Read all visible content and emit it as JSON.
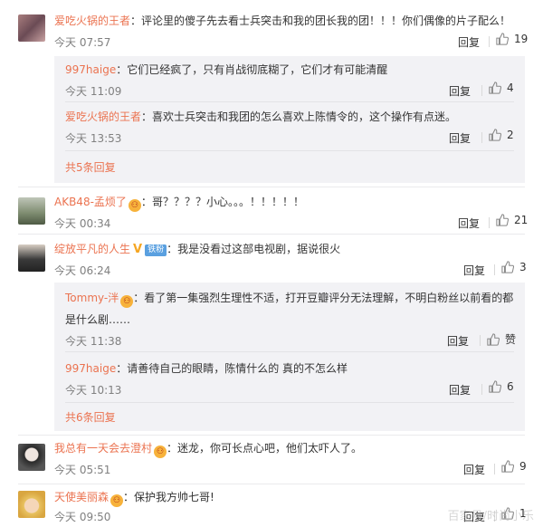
{
  "comments": [
    {
      "user": "爱吃火锅的王者",
      "text": "评论里的傻子先去看士兵突击和我的团长我的团！！！你们偶像的片子配么！",
      "time": "今天 07:57",
      "reply": "回复",
      "likes": "19",
      "replies": [
        {
          "user": "997haige",
          "text": "它们已经疯了，只有肖战彻底糊了，它们才有可能清醒",
          "time": "今天 11:09",
          "reply": "回复",
          "likes": "4"
        },
        {
          "user": "爱吃火锅的王者",
          "text": "喜欢士兵突击和我团的怎么喜欢上陈情令的，这个操作有点迷。",
          "time": "今天 13:53",
          "reply": "回复",
          "likes": "2"
        }
      ],
      "more": "共5条回复"
    },
    {
      "user": "AKB48-孟烦了",
      "text": "哥？？？？小心。。。！！！！！",
      "time": "今天 00:34",
      "reply": "回复",
      "likes": "21"
    },
    {
      "user": "绽放平凡的人生",
      "badge": "铁粉",
      "text": "我是没看过这部电视剧，据说很火",
      "time": "今天 06:24",
      "reply": "回复",
      "likes": "3",
      "replies": [
        {
          "user": "Tommy-泮",
          "text": "看了第一集强烈生理性不适，打开豆瓣评分无法理解，不明白粉丝以前看的都",
          "text2": "是什么剧……",
          "time": "今天 11:38",
          "reply": "回复",
          "likes": "赞"
        },
        {
          "user": "997haige",
          "text": "请善待自己的眼睛，陈情什么的 真的不怎么样",
          "time": "今天 10:13",
          "reply": "回复",
          "likes": "6"
        }
      ],
      "more": "共6条回复"
    },
    {
      "user": "我总有一天会去澄村",
      "text": "迷龙，你可长点心吧，他们太吓人了。",
      "time": "今天 05:51",
      "reply": "回复",
      "likes": "9"
    },
    {
      "user": "天使美丽森",
      "text": "保护我方帅七哥!",
      "time": "今天 09:50",
      "reply": "回复",
      "likes": "1"
    }
  ],
  "colors": {
    "username": "#eb7350",
    "time": "#808080",
    "reply_bg": "#f2f2f5"
  },
  "watermark": "百家号/时尚小乐"
}
